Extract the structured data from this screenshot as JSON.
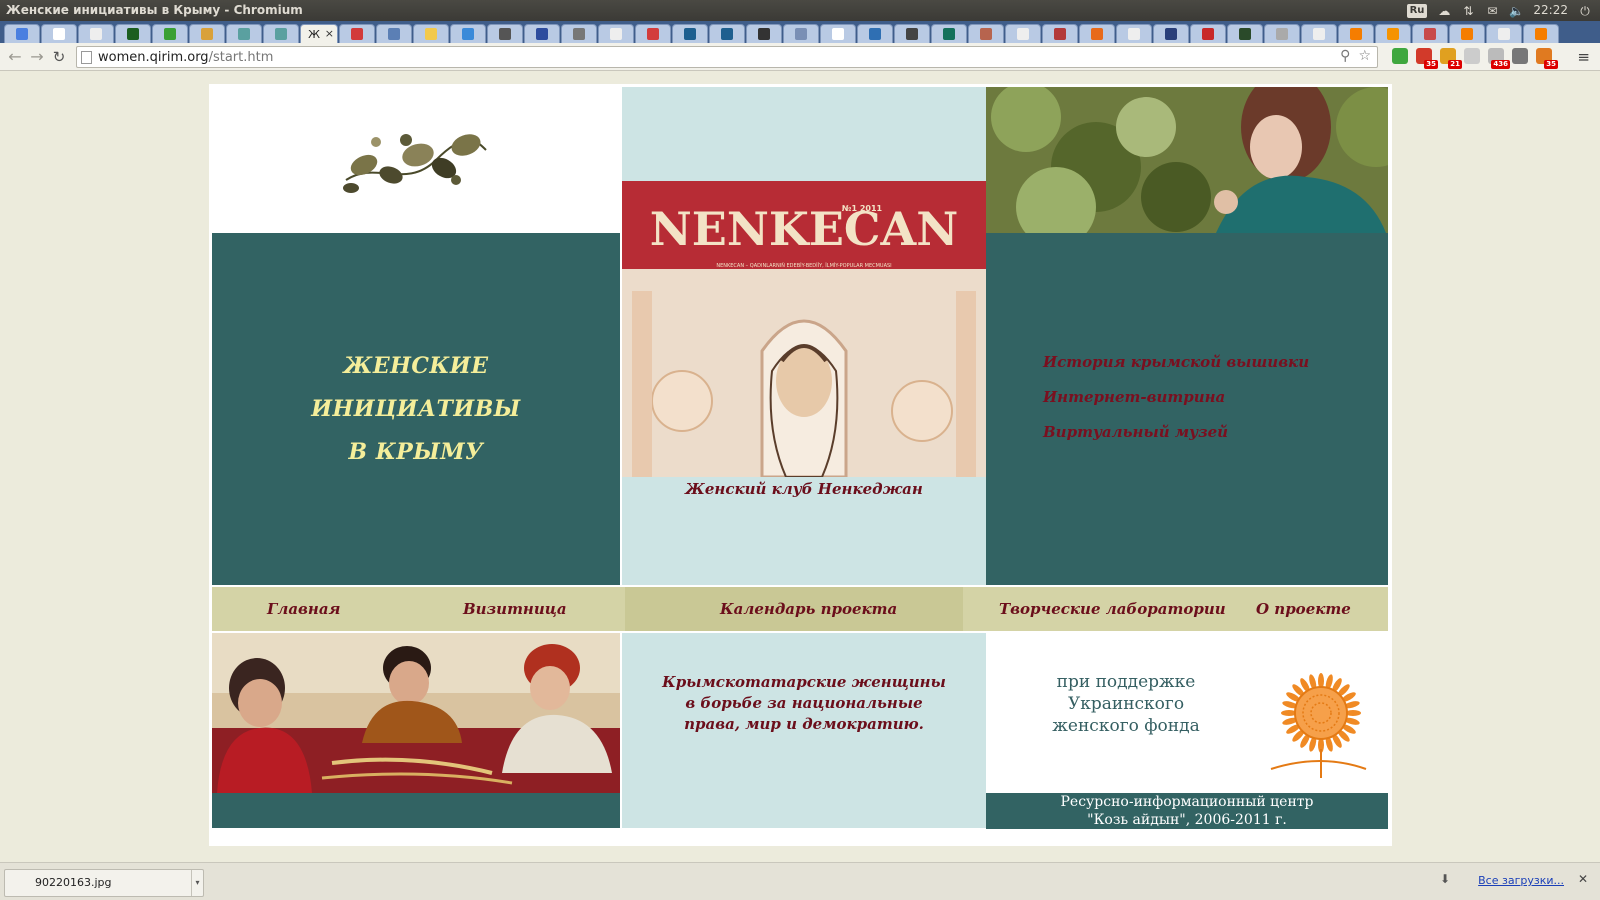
{
  "window": {
    "title": "Женские инициативы в Крыму - Chromium",
    "tray": {
      "lang": "Ru",
      "time": "22:22"
    }
  },
  "tabs": [
    {
      "icon": "google-icon",
      "color": "#4a7fe0"
    },
    {
      "icon": "abbyy-icon",
      "color": "#ffffff"
    },
    {
      "icon": "page-icon",
      "color": "#eeeeee"
    },
    {
      "icon": "chart-icon",
      "color": "#1b5e20"
    },
    {
      "icon": "clover-icon",
      "color": "#3aa035"
    },
    {
      "icon": "x-icon",
      "color": "#d9a13a"
    },
    {
      "icon": "h-icon",
      "color": "#5aa0a0"
    },
    {
      "icon": "h-icon",
      "color": "#5aa0a0"
    },
    {
      "icon": "active",
      "color": "#ffffff"
    },
    {
      "icon": "book-icon",
      "color": "#d23a3a"
    },
    {
      "icon": "list-icon",
      "color": "#5b7fb5"
    },
    {
      "icon": "sun-icon",
      "color": "#f2c94c"
    },
    {
      "icon": "e-icon",
      "color": "#3a8ad9"
    },
    {
      "icon": "photo-icon",
      "color": "#555555"
    },
    {
      "icon": "shield-icon",
      "color": "#2d4c9e"
    },
    {
      "icon": "clip-icon",
      "color": "#777777"
    },
    {
      "icon": "page-icon",
      "color": "#eeeeee"
    },
    {
      "icon": "r-icon",
      "color": "#d33c3c"
    },
    {
      "icon": "chart-icon",
      "color": "#1e5f8f"
    },
    {
      "icon": "chart-icon",
      "color": "#1e5f8f"
    },
    {
      "icon": "person-icon",
      "color": "#333333"
    },
    {
      "icon": "circle-icon",
      "color": "#7a8fb5"
    },
    {
      "icon": "calendar-icon",
      "color": "#ffffff"
    },
    {
      "icon": "doc-icon",
      "color": "#2f6fb3"
    },
    {
      "icon": "b-icon",
      "color": "#444444"
    },
    {
      "icon": "chart-icon",
      "color": "#13715c"
    },
    {
      "icon": "avatar-icon",
      "color": "#b7644e"
    },
    {
      "icon": "page-icon",
      "color": "#eeeeee"
    },
    {
      "icon": "globe-icon",
      "color": "#b33a3a"
    },
    {
      "icon": "star-icon",
      "color": "#e86a1a"
    },
    {
      "icon": "page-icon",
      "color": "#eeeeee"
    },
    {
      "icon": "gear-icon",
      "color": "#2a3f7a"
    },
    {
      "icon": "plane-icon",
      "color": "#c82828"
    },
    {
      "icon": "text-icon",
      "color": "#2a4a2a"
    },
    {
      "icon": "swirl-icon",
      "color": "#aaaaaa"
    },
    {
      "icon": "page-icon",
      "color": "#eeeeee"
    },
    {
      "icon": "blogger-icon",
      "color": "#f57d00"
    },
    {
      "icon": "ok-icon",
      "color": "#f59300"
    },
    {
      "icon": "grid-icon",
      "color": "#c84a4a"
    },
    {
      "icon": "blogger-icon",
      "color": "#f57d00"
    },
    {
      "icon": "page-icon",
      "color": "#eeeeee"
    },
    {
      "icon": "blogger-icon",
      "color": "#f57d00"
    }
  ],
  "active_tab_label": "Ж",
  "toolbar": {
    "url_host": "women.qirim.org",
    "url_path": "/start.htm",
    "extensions": [
      {
        "icon": "green-dot-icon",
        "color": "#3fa73f",
        "badge": ""
      },
      {
        "icon": "gmail-icon",
        "color": "#d23a2a",
        "badge": "35"
      },
      {
        "icon": "chrome-icon",
        "color": "#e0a020",
        "badge": "21"
      },
      {
        "icon": "panel-icon",
        "color": "#cccccc",
        "badge": ""
      },
      {
        "icon": "calendar-icon",
        "color": "#bbbbbb",
        "badge": "436"
      },
      {
        "icon": "wrench-icon",
        "color": "#777777",
        "badge": ""
      },
      {
        "icon": "rss-icon",
        "color": "#e07a20",
        "badge": "35"
      }
    ]
  },
  "site": {
    "title_lines": [
      "ЖЕНСКИЕ",
      "ИНИЦИАТИВЫ",
      "В КРЫМУ"
    ],
    "magazine": {
      "logo_text": "NENKECAN",
      "issue": "№1 2011",
      "subtitle": "NENKECAN – QADINLARNIÑ EDEBİY-BEDİİY, İLMİY-POPULAR MECMUASI"
    },
    "magazine_caption": "Женский клуб Ненкеджан",
    "side_links": [
      "История крымской вышивки",
      "Интернет-витрина",
      "Виртуальный музей"
    ],
    "nav": [
      "Главная",
      "Визитница",
      "Календарь проекта",
      "Творческие лаборатории",
      "О проекте"
    ],
    "motto": [
      "Крымскотатарские женщины",
      "в борьбе за национальные",
      "права, мир и демократию."
    ],
    "support": [
      "при поддержке",
      "Украинского",
      "женского фонда"
    ],
    "footer": [
      "Ресурсно-информационный центр",
      "\"Козь айдын\", 2006-2011 г."
    ]
  },
  "downloads": {
    "item": "90220163.jpg",
    "all_label": "Все загрузки..."
  },
  "colors": {
    "teal": "#326363",
    "light_blue": "#cde4e4",
    "nav_tan": "#d4d3a6",
    "title_yellow": "#f5ee9a",
    "link_maroon": "#7a0f1f",
    "sun_orange": "#f08a24"
  }
}
